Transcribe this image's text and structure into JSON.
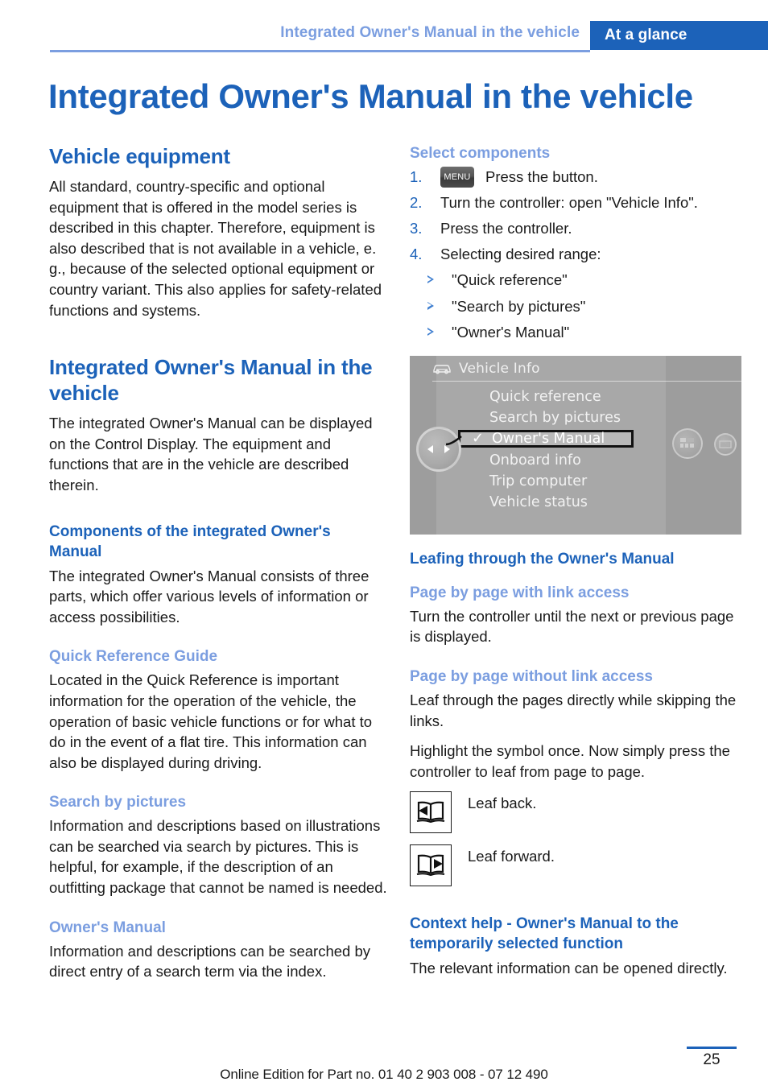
{
  "header": {
    "chapter_label": "Integrated Owner's Manual in the vehicle",
    "section_tab": "At a glance",
    "tab_color": "#1c62b9",
    "rule_color": "#7b9ee0"
  },
  "page_title": "Integrated Owner's Manual in the vehicle",
  "left_column": {
    "vehicle_equipment": {
      "heading": "Vehicle equipment",
      "body": "All standard, country-specific and optional equipment that is offered in the model series is described in this chapter. Therefore, equipment is also described that is not available in a vehicle, e. g., because of the selected optional equipment or country variant. This also applies for safety-related functions and systems."
    },
    "integrated_manual": {
      "heading": "Integrated Owner's Manual in the vehicle",
      "body": "The integrated Owner's Manual can be displayed on the Control Display. The equipment and functions that are in the vehicle are described therein."
    },
    "components": {
      "heading": "Components of the integrated Owner's Manual",
      "body": "The integrated Owner's Manual consists of three parts, which offer various levels of information or access possibilities."
    },
    "quick_reference": {
      "heading": "Quick Reference Guide",
      "body": "Located in the Quick Reference is important information for the operation of the vehicle, the operation of basic vehicle functions or for what to do in the event of a flat tire. This information can also be displayed during driving."
    },
    "search_by_pictures": {
      "heading": "Search by pictures",
      "body": "Information and descriptions based on illustrations can be searched via search by pictures. This is helpful, for example, if the description of an outfitting package that cannot be named is needed."
    },
    "owners_manual": {
      "heading": "Owner's Manual",
      "body": "Information and descriptions can be searched by direct entry of a search term via the index."
    }
  },
  "right_column": {
    "select_components": {
      "heading": "Select components",
      "steps": [
        {
          "num": "1.",
          "button": "MENU",
          "text": "Press the button."
        },
        {
          "num": "2.",
          "text": "Turn the controller: open \"Vehicle Info\"."
        },
        {
          "num": "3.",
          "text": "Press the controller."
        },
        {
          "num": "4.",
          "text": "Selecting desired range:"
        }
      ],
      "sub_options": [
        "\"Quick reference\"",
        "\"Search by pictures\"",
        "\"Owner's Manual\""
      ]
    },
    "idrive_screen": {
      "title": "Vehicle Info",
      "menu_items": [
        {
          "label": "Quick reference",
          "selected": false
        },
        {
          "label": "Search by pictures",
          "selected": false
        },
        {
          "label": "Owner's Manual",
          "selected": true,
          "check": "✓"
        },
        {
          "label": "Onboard info",
          "selected": false
        },
        {
          "label": "Trip computer",
          "selected": false
        },
        {
          "label": "Vehicle status",
          "selected": false
        }
      ]
    },
    "leafing": {
      "heading": "Leafing through the Owner's Manual"
    },
    "page_with_link": {
      "heading": "Page by page with link access",
      "body": "Turn the controller until the next or previous page is displayed."
    },
    "page_without_link": {
      "heading": "Page by page without link access",
      "body1": "Leaf through the pages directly while skipping the links.",
      "body2": "Highlight the symbol once. Now simply press the controller to leaf from page to page.",
      "symbols": [
        {
          "icon": "book-leaf-back-icon",
          "label": "Leaf back."
        },
        {
          "icon": "book-leaf-forward-icon",
          "label": "Leaf forward."
        }
      ]
    },
    "context_help": {
      "heading": "Context help - Owner's Manual to the temporarily selected function",
      "body": "The relevant information can be opened directly."
    }
  },
  "footer": {
    "edition_text": "Online Edition for Part no. 01 40 2 903 008 - 07 12 490",
    "page_number": "25"
  }
}
